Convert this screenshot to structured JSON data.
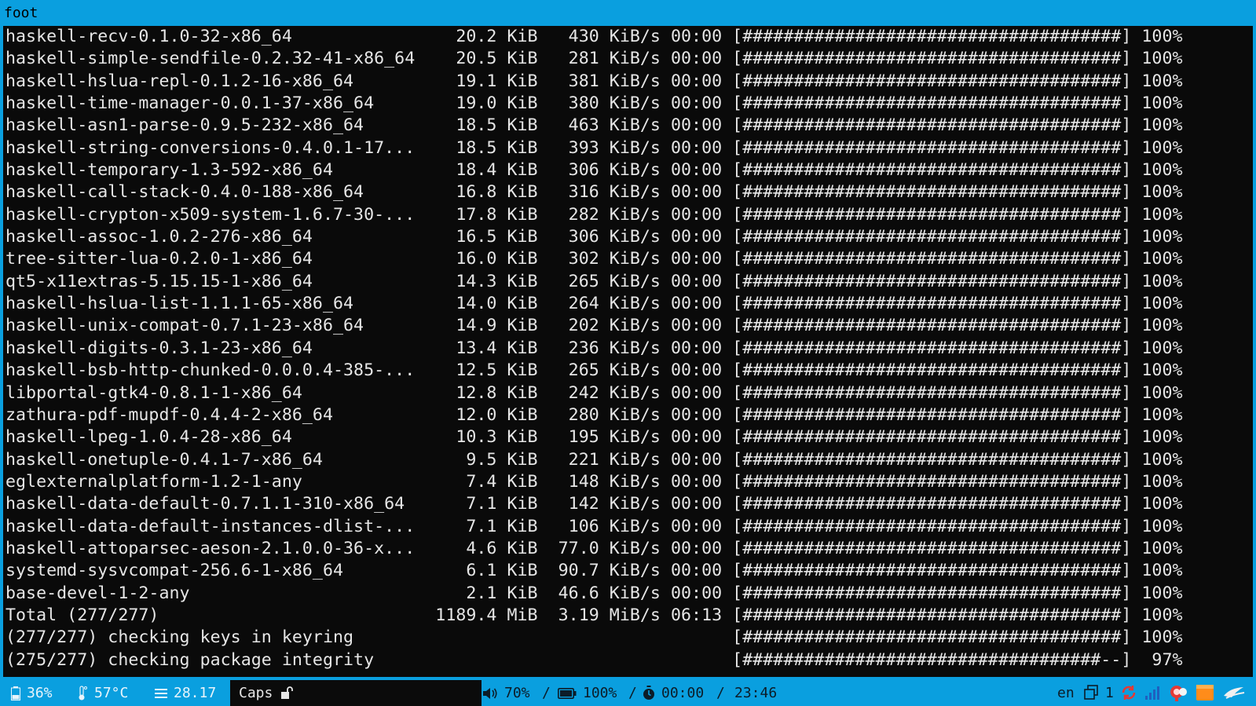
{
  "window": {
    "title": "foot"
  },
  "terminal": {
    "lines": [
      "haskell-recv-0.1.0-32-x86_64                20.2 KiB   430 KiB/s 00:00 [#####################################] 100%",
      "haskell-simple-sendfile-0.2.32-41-x86_64    20.5 KiB   281 KiB/s 00:00 [#####################################] 100%",
      "haskell-hslua-repl-0.1.2-16-x86_64          19.1 KiB   381 KiB/s 00:00 [#####################################] 100%",
      "haskell-time-manager-0.0.1-37-x86_64        19.0 KiB   380 KiB/s 00:00 [#####################################] 100%",
      "haskell-asn1-parse-0.9.5-232-x86_64         18.5 KiB   463 KiB/s 00:00 [#####################################] 100%",
      "haskell-string-conversions-0.4.0.1-17...    18.5 KiB   393 KiB/s 00:00 [#####################################] 100%",
      "haskell-temporary-1.3-592-x86_64            18.4 KiB   306 KiB/s 00:00 [#####################################] 100%",
      "haskell-call-stack-0.4.0-188-x86_64         16.8 KiB   316 KiB/s 00:00 [#####################################] 100%",
      "haskell-crypton-x509-system-1.6.7-30-...    17.8 KiB   282 KiB/s 00:00 [#####################################] 100%",
      "haskell-assoc-1.0.2-276-x86_64              16.5 KiB   306 KiB/s 00:00 [#####################################] 100%",
      "tree-sitter-lua-0.2.0-1-x86_64              16.0 KiB   302 KiB/s 00:00 [#####################################] 100%",
      "qt5-x11extras-5.15.15-1-x86_64              14.3 KiB   265 KiB/s 00:00 [#####################################] 100%",
      "haskell-hslua-list-1.1.1-65-x86_64          14.0 KiB   264 KiB/s 00:00 [#####################################] 100%",
      "haskell-unix-compat-0.7.1-23-x86_64         14.9 KiB   202 KiB/s 00:00 [#####################################] 100%",
      "haskell-digits-0.3.1-23-x86_64              13.4 KiB   236 KiB/s 00:00 [#####################################] 100%",
      "haskell-bsb-http-chunked-0.0.0.4-385-...    12.5 KiB   265 KiB/s 00:00 [#####################################] 100%",
      "libportal-gtk4-0.8.1-1-x86_64               12.8 KiB   242 KiB/s 00:00 [#####################################] 100%",
      "zathura-pdf-mupdf-0.4.4-2-x86_64            12.0 KiB   280 KiB/s 00:00 [#####################################] 100%",
      "haskell-lpeg-1.0.4-28-x86_64                10.3 KiB   195 KiB/s 00:00 [#####################################] 100%",
      "haskell-onetuple-0.4.1-7-x86_64              9.5 KiB   221 KiB/s 00:00 [#####################################] 100%",
      "eglexternalplatform-1.2-1-any                7.4 KiB   148 KiB/s 00:00 [#####################################] 100%",
      "haskell-data-default-0.7.1.1-310-x86_64      7.1 KiB   142 KiB/s 00:00 [#####################################] 100%",
      "haskell-data-default-instances-dlist-...     7.1 KiB   106 KiB/s 00:00 [#####################################] 100%",
      "haskell-attoparsec-aeson-2.1.0.0-36-x...     4.6 KiB  77.0 KiB/s 00:00 [#####################################] 100%",
      "systemd-sysvcompat-256.6-1-x86_64            6.1 KiB  90.7 KiB/s 00:00 [#####################################] 100%",
      "base-devel-1-2-any                           2.1 KiB  46.6 KiB/s 00:00 [#####################################] 100%",
      "Total (277/277)                           1189.4 MiB  3.19 MiB/s 06:13 [#####################################] 100%",
      "(277/277) checking keys in keyring                                     [#####################################] 100%",
      "(275/277) checking package integrity                                   [###################################--]  97%"
    ]
  },
  "statusbar": {
    "battery_left": "36%",
    "temperature": "57°C",
    "load": "28.17",
    "caps_label": "Caps",
    "volume": "70%",
    "sep1": "/",
    "battery": "100%",
    "sep2": "/",
    "timer": "00:00",
    "sep3": "/",
    "clock": "23:46",
    "layout": "en",
    "workspace": "1",
    "icons": {
      "battery_left": "battery-icon",
      "temperature": "thermometer-icon",
      "load": "cpu-load-icon",
      "lock": "unlocked-icon",
      "volume": "speaker-icon",
      "battery": "battery-icon",
      "timer": "stopwatch-icon",
      "workspace": "window-stack-icon",
      "sync": "sync-icon",
      "signal": "signal-icon",
      "notify": "notification-icon",
      "folder": "folder-icon",
      "app": "app-launcher-icon"
    },
    "colors": {
      "bar": "#0a9fdf",
      "sync": "#e53935",
      "signal": "#1f5fbf",
      "folder": "#ff8c1a"
    }
  }
}
